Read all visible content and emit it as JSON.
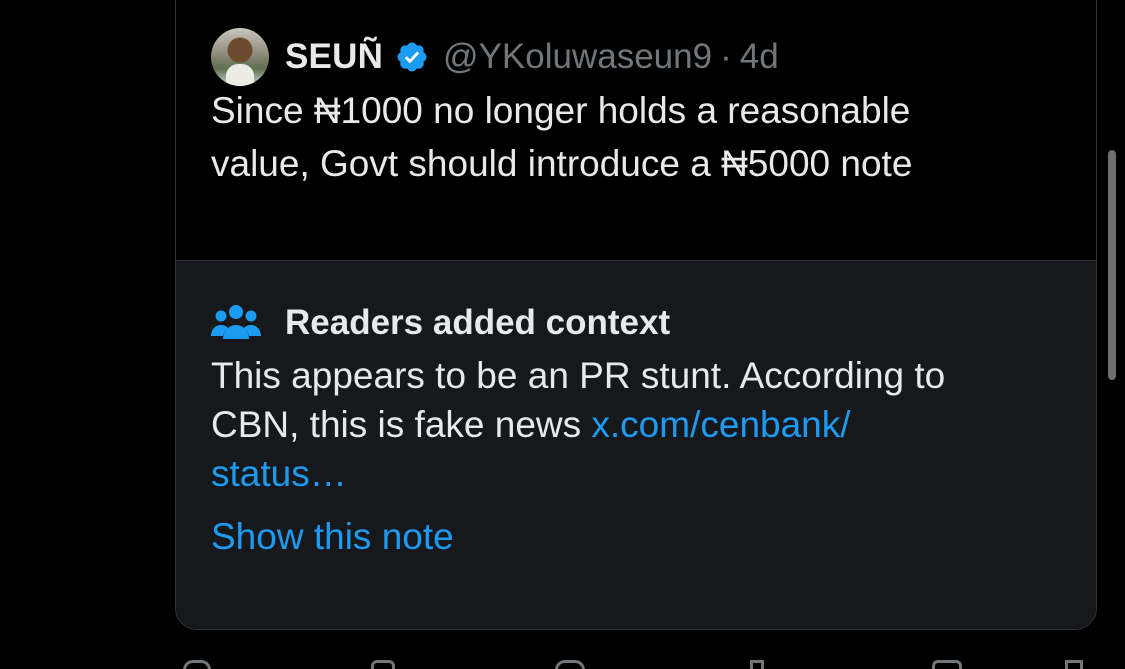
{
  "quoted_tweet": {
    "author_name": "SEUÑ",
    "handle": "@YKoluwaseun9",
    "separator": "·",
    "time": "4d",
    "text_line1": "Since ₦1000 no longer holds a reasonable",
    "text_line2": "value, Govt should introduce a ₦5000 note",
    "avatar_icon": "avatar",
    "verified_icon": "verified-badge-icon"
  },
  "community_note": {
    "icon": "people-icon",
    "title": "Readers added context",
    "text_line1": "This appears to be an PR stunt. According to",
    "text_line2": "CBN, this is fake news ",
    "link_text_part1": "x.com/cenbank/",
    "link_text_part2": "status…",
    "show_note_label": "Show this note"
  },
  "colors": {
    "background": "#000000",
    "text": "#e7e9ea",
    "muted": "#71767b",
    "link": "#1d9bf0",
    "note_bg": "#16181c",
    "border": "#2f3336"
  },
  "action_icons": [
    "reply-icon",
    "retweet-icon",
    "like-icon",
    "views-icon",
    "bookmark-icon",
    "share-icon"
  ]
}
